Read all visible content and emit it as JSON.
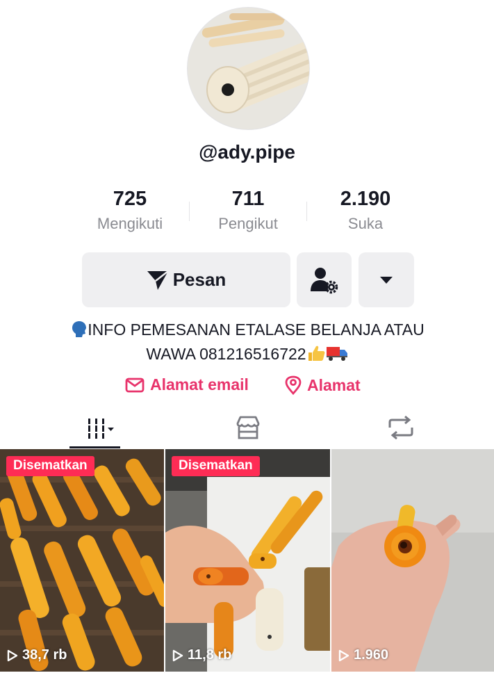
{
  "profile": {
    "username": "@ady.pipe",
    "avatar_alt": "avatar"
  },
  "stats": [
    {
      "value": "725",
      "label": "Mengikuti"
    },
    {
      "value": "711",
      "label": "Pengikut"
    },
    {
      "value": "2.190",
      "label": "Suka"
    }
  ],
  "actions": {
    "message_label": "Pesan",
    "message_icon": "send-icon",
    "friend_icon": "user-settings-icon",
    "more_icon": "caret-down-icon"
  },
  "bio": {
    "line1": "INFO PEMESANAN ETALASE BELANJA ATAU",
    "line2": "WAWA 081216516722",
    "prefix_emoji": "speaking-head-emoji",
    "suffix_emojis": [
      "thumbs-up-emoji",
      "truck-emoji"
    ]
  },
  "links": {
    "email_label": "Alamat email",
    "address_label": "Alamat",
    "accent": "#e8336b"
  },
  "tabs": [
    {
      "icon": "videos-grid-icon",
      "active": true
    },
    {
      "icon": "shop-icon",
      "active": false
    },
    {
      "icon": "repost-icon",
      "active": false
    }
  ],
  "videos": [
    {
      "pinned_label": "Disematkan",
      "views": "38,7 rb"
    },
    {
      "pinned_label": "Disematkan",
      "views": "11,8 rb"
    },
    {
      "pinned_label": "",
      "views": "1.960"
    }
  ],
  "colors": {
    "badge": "#fe2c55",
    "button_bg": "#efeff1",
    "muted_text": "#8a8b91"
  }
}
